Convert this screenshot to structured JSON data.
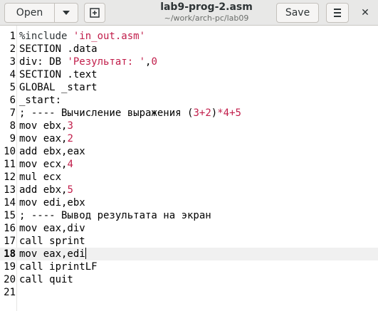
{
  "header": {
    "open_label": "Open",
    "title": "lab9-prog-2.asm",
    "subtitle": "~/work/arch-pc/lab09",
    "save_label": "Save",
    "close_glyph": "✕"
  },
  "editor": {
    "current_line": 18,
    "lines": [
      {
        "n": "1",
        "parts": [
          {
            "t": "%include ",
            "c": "c-kw"
          },
          {
            "t": "'in_out.asm'",
            "c": "c-str"
          }
        ]
      },
      {
        "n": "2",
        "parts": [
          {
            "t": "SECTION .data",
            "c": ""
          }
        ]
      },
      {
        "n": "3",
        "parts": [
          {
            "t": "div: DB ",
            "c": ""
          },
          {
            "t": "'Результат: '",
            "c": "c-str"
          },
          {
            "t": ",",
            "c": ""
          },
          {
            "t": "0",
            "c": "c-num"
          }
        ]
      },
      {
        "n": "4",
        "parts": [
          {
            "t": "SECTION .text",
            "c": ""
          }
        ]
      },
      {
        "n": "5",
        "parts": [
          {
            "t": "GLOBAL _start",
            "c": ""
          }
        ]
      },
      {
        "n": "6",
        "parts": [
          {
            "t": "_start:",
            "c": ""
          }
        ]
      },
      {
        "n": "7",
        "parts": [
          {
            "t": "; ---- Вычисление выражения (",
            "c": ""
          },
          {
            "t": "3",
            "c": "c-num"
          },
          {
            "t": "+",
            "c": "c-red"
          },
          {
            "t": "2",
            "c": "c-num"
          },
          {
            "t": ")",
            "c": ""
          },
          {
            "t": "*",
            "c": "c-red"
          },
          {
            "t": "4",
            "c": "c-num"
          },
          {
            "t": "+",
            "c": "c-red"
          },
          {
            "t": "5",
            "c": "c-num"
          }
        ]
      },
      {
        "n": "8",
        "parts": [
          {
            "t": "mov ebx,",
            "c": ""
          },
          {
            "t": "3",
            "c": "c-num"
          }
        ]
      },
      {
        "n": "9",
        "parts": [
          {
            "t": "mov eax,",
            "c": ""
          },
          {
            "t": "2",
            "c": "c-num"
          }
        ]
      },
      {
        "n": "10",
        "parts": [
          {
            "t": "add ebx,eax",
            "c": ""
          }
        ]
      },
      {
        "n": "11",
        "parts": [
          {
            "t": "mov ecx,",
            "c": ""
          },
          {
            "t": "4",
            "c": "c-num"
          }
        ]
      },
      {
        "n": "12",
        "parts": [
          {
            "t": "mul ecx",
            "c": ""
          }
        ]
      },
      {
        "n": "13",
        "parts": [
          {
            "t": "add ebx,",
            "c": ""
          },
          {
            "t": "5",
            "c": "c-num"
          }
        ]
      },
      {
        "n": "14",
        "parts": [
          {
            "t": "mov edi,ebx",
            "c": ""
          }
        ]
      },
      {
        "n": "15",
        "parts": [
          {
            "t": "; ---- Вывод результата на экран",
            "c": ""
          }
        ]
      },
      {
        "n": "16",
        "parts": [
          {
            "t": "mov eax,div",
            "c": ""
          }
        ]
      },
      {
        "n": "17",
        "parts": [
          {
            "t": "call sprint",
            "c": ""
          }
        ]
      },
      {
        "n": "18",
        "parts": [
          {
            "t": "mov eax,edi",
            "c": ""
          }
        ]
      },
      {
        "n": "19",
        "parts": [
          {
            "t": "call iprintLF",
            "c": ""
          }
        ]
      },
      {
        "n": "20",
        "parts": [
          {
            "t": "call quit",
            "c": ""
          }
        ]
      },
      {
        "n": "21",
        "parts": []
      }
    ]
  }
}
